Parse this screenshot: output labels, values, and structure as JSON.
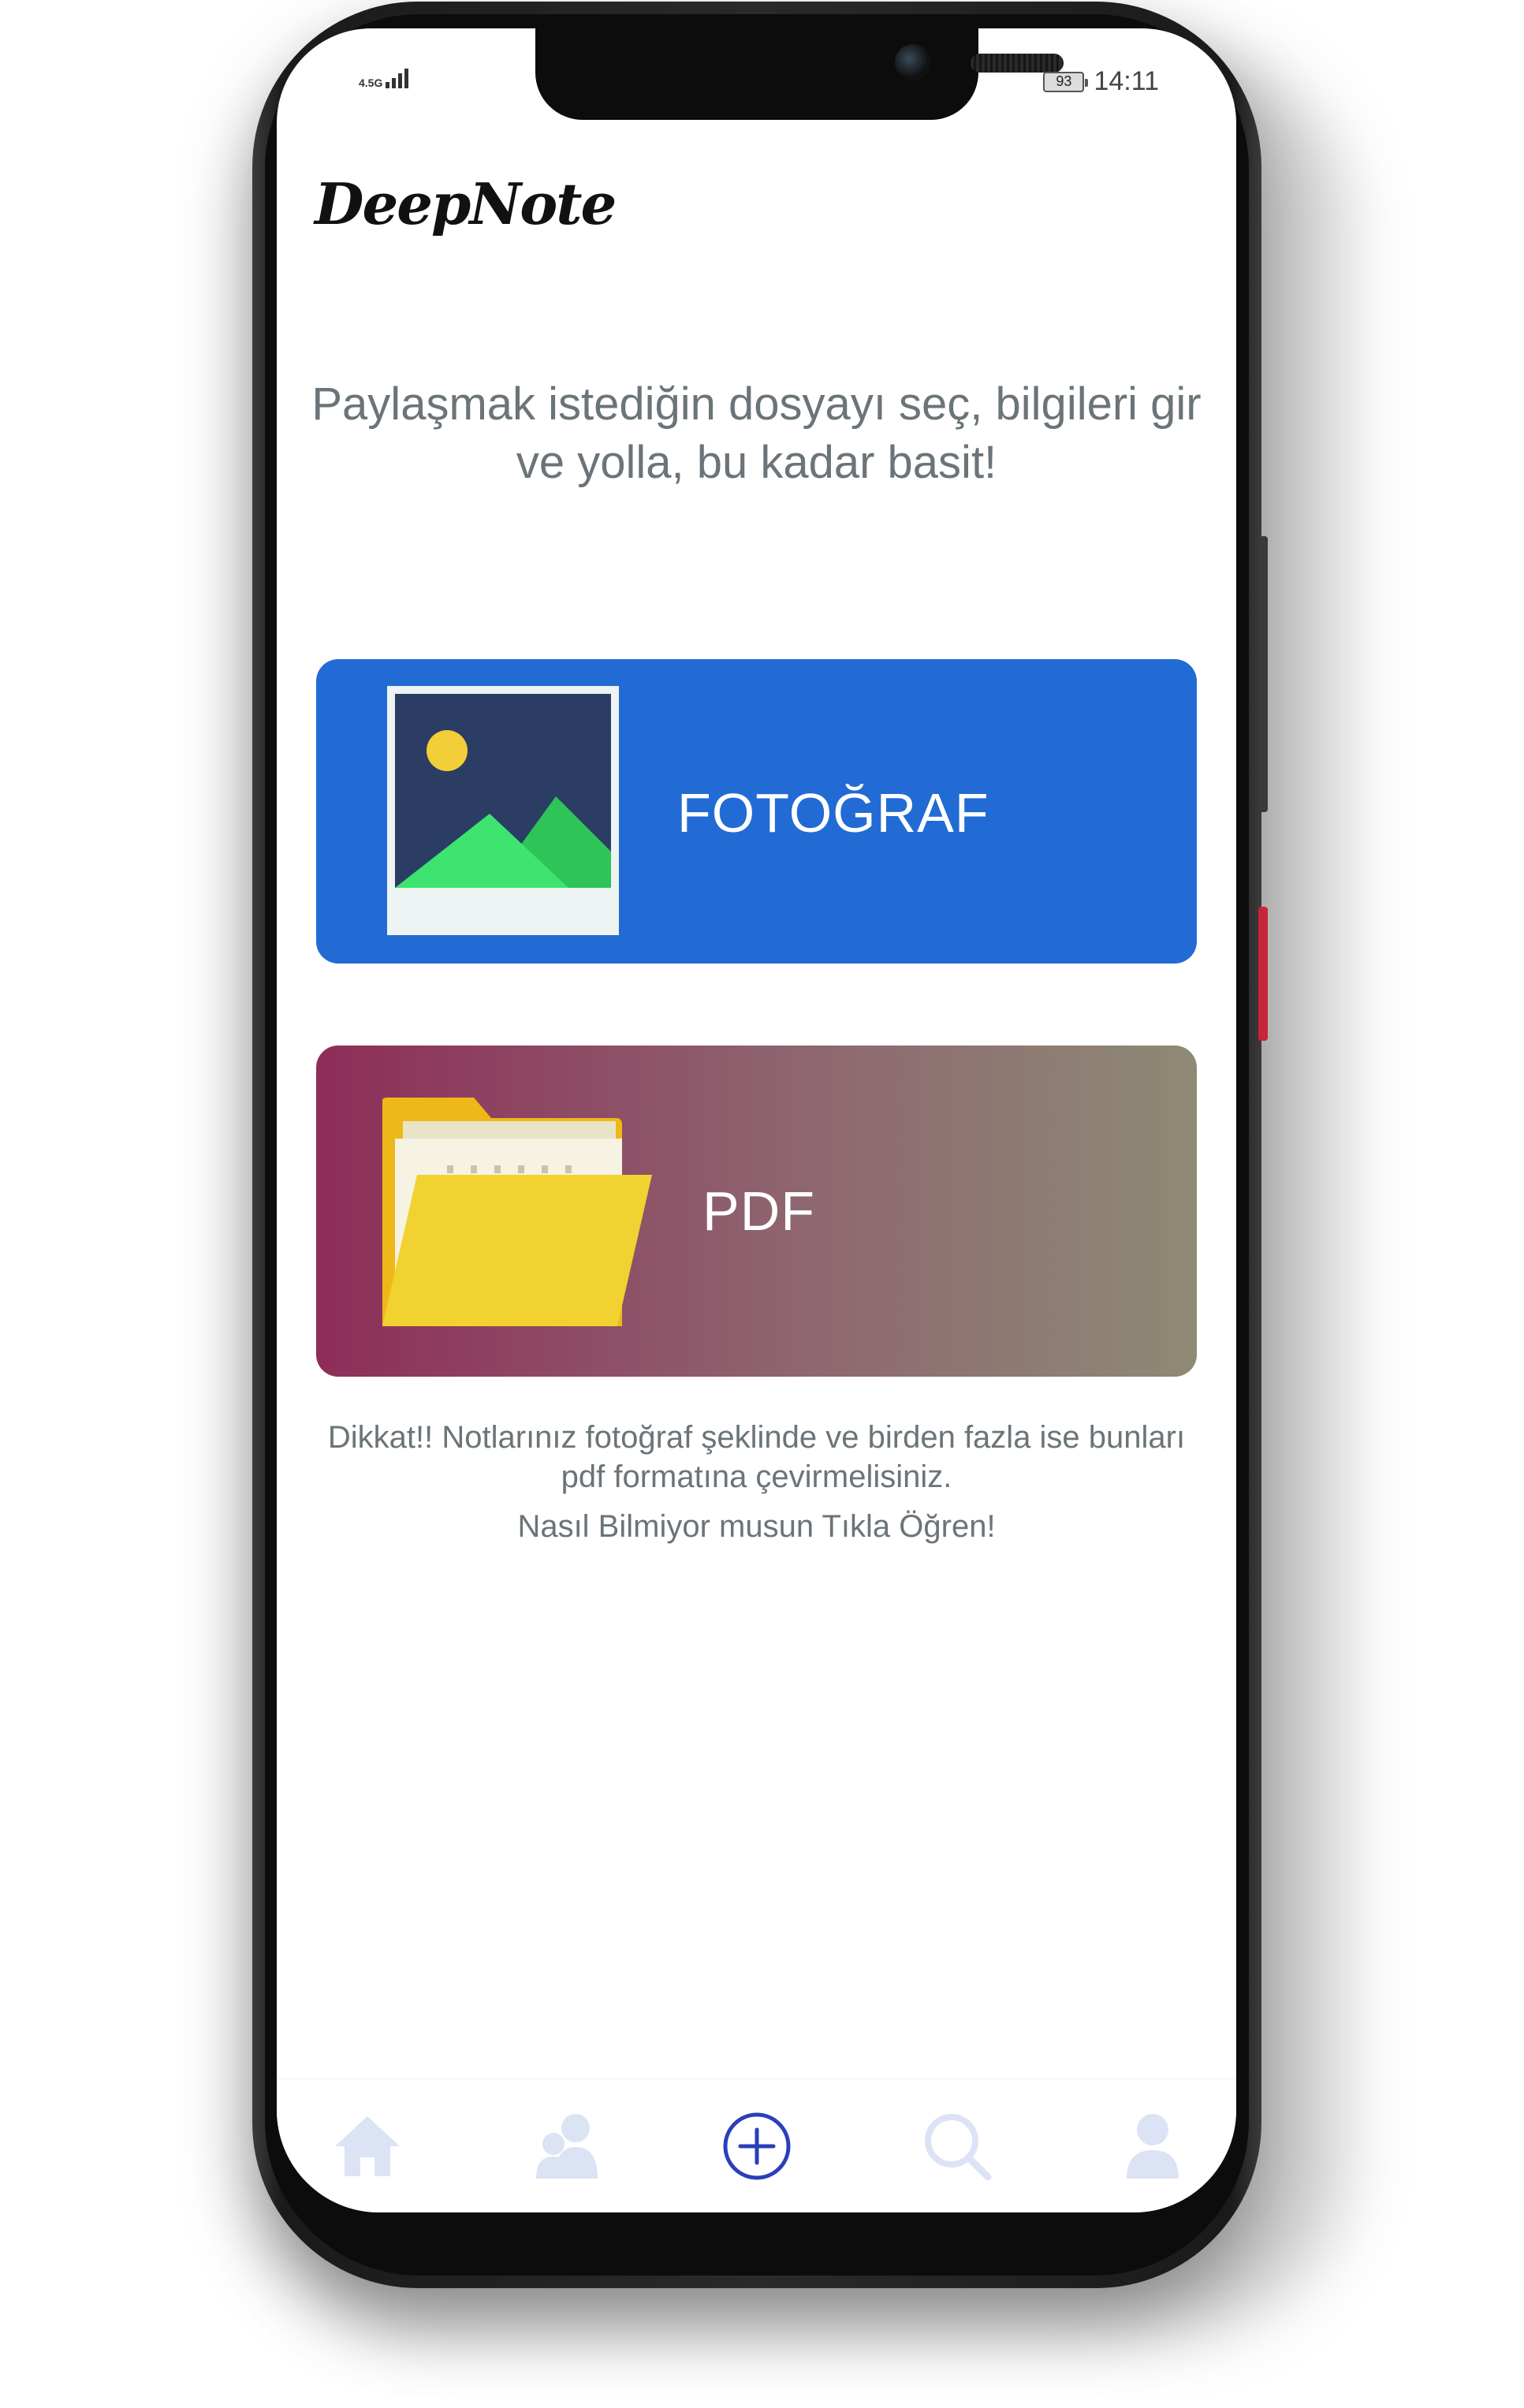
{
  "status_bar": {
    "network": "4.5G",
    "battery": "93",
    "time": "14:11"
  },
  "app": {
    "logo": "DeepNote"
  },
  "main": {
    "intro": "Paylaşmak istediğin dosyayı seç, bilgileri gir ve yolla, bu kadar basit!",
    "cards": [
      {
        "label": "FOTOĞRAF",
        "icon": "image-icon",
        "color": "#226bd4"
      },
      {
        "label": "PDF",
        "icon": "folder-icon",
        "gradient": [
          "#8e2d58",
          "#8e8a75"
        ]
      }
    ],
    "warning": "Dikkat!! Notlarınız fotoğraf şeklinde ve birden fazla ise bunları pdf formatına çevirmelisiniz.",
    "learn_link": "Nasıl Bilmiyor musun Tıkla Öğren!"
  },
  "tabbar": {
    "items": [
      {
        "icon": "home-icon",
        "active": false
      },
      {
        "icon": "group-icon",
        "active": false
      },
      {
        "icon": "add-icon",
        "active": true
      },
      {
        "icon": "search-icon",
        "active": false
      },
      {
        "icon": "profile-icon",
        "active": false
      }
    ],
    "active_color": "#2a3fb8",
    "inactive_color": "#dbe3f5"
  }
}
